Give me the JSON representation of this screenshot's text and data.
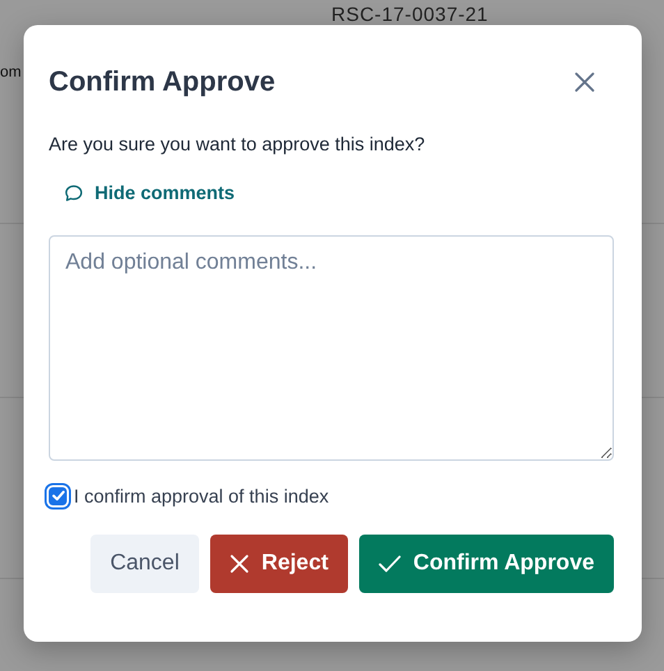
{
  "background": {
    "texts": [
      "RSC-17-0037-21",
      "om"
    ]
  },
  "dialog": {
    "title": "Confirm Approve",
    "message": "Are you sure you want to approve this index?",
    "comments_toggle": "Hide comments",
    "comments": {
      "placeholder": "Add optional comments..."
    },
    "confirmation": {
      "label": "I confirm approval of this index",
      "checked": true
    },
    "buttons": [
      {
        "kind": "cancel",
        "label": "Cancel"
      },
      {
        "kind": "reject",
        "label": "Reject"
      },
      {
        "kind": "approve",
        "label": "Confirm Approve"
      }
    ]
  }
}
